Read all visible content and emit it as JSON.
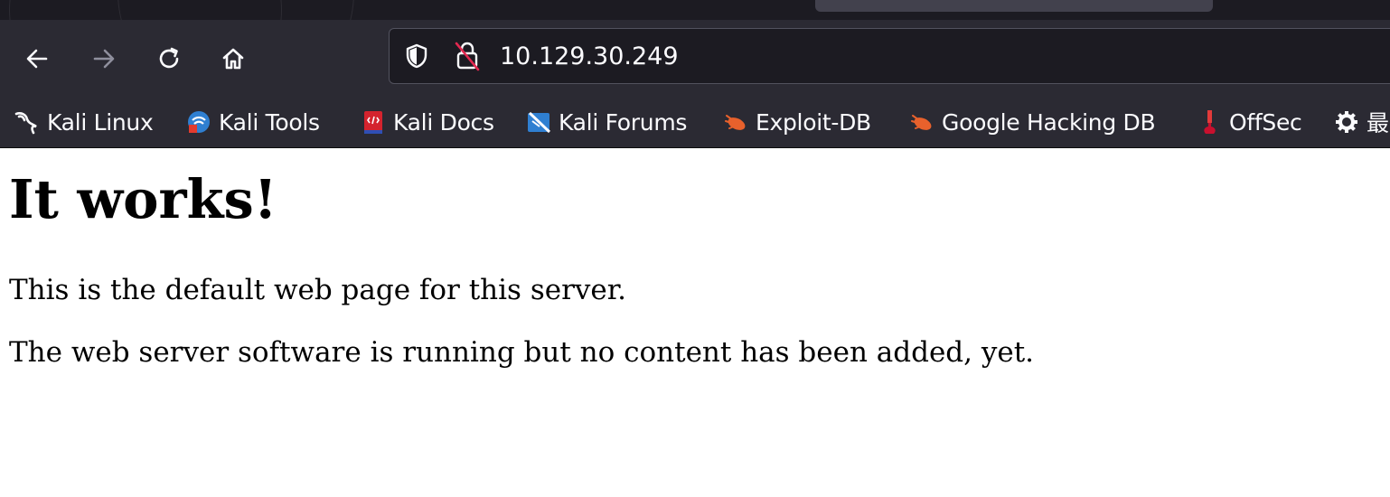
{
  "browser": {
    "url": "10.129.30.249",
    "bookmarks": [
      {
        "label": "Kali Linux",
        "icon": "kali-dragon-icon"
      },
      {
        "label": "Kali Tools",
        "icon": "kali-tools-icon"
      },
      {
        "label": "Kali Docs",
        "icon": "kali-docs-icon"
      },
      {
        "label": "Kali Forums",
        "icon": "kali-forums-icon"
      },
      {
        "label": "Exploit-DB",
        "icon": "exploit-db-icon"
      },
      {
        "label": "Google Hacking DB",
        "icon": "ghdb-icon"
      },
      {
        "label": "OffSec",
        "icon": "offsec-icon"
      },
      {
        "label": "最",
        "icon": "gear-icon"
      }
    ]
  },
  "page": {
    "heading": "It works!",
    "paragraph1": "This is the default web page for this server.",
    "paragraph2": "The web server software is running but no content has been added, yet."
  },
  "colors": {
    "toolbar": "#2b2a33",
    "tabstrip": "#1c1b22",
    "urlbar": "#1c1b22",
    "exploit_orange": "#e8612c",
    "offsec_red": "#c8102e"
  }
}
